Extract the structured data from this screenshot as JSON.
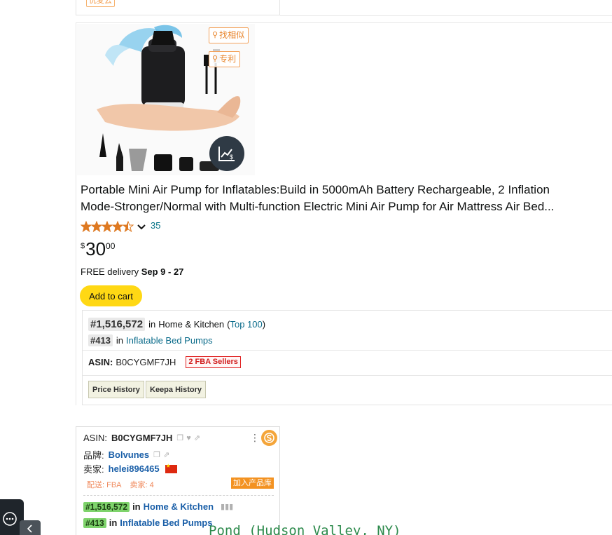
{
  "top_card": {
    "tag": "优麦云"
  },
  "product": {
    "image_tools": {
      "find_similar": "找相似",
      "patent": "专利"
    },
    "title_line1": "Portable Mini Air Pump for Inflatables:Build in 5000mAh Battery Rechargeable, 2 Inflation",
    "title_line2": "Mode-Stronger/Normal with Multi-function Electric Mini Air Pump for Air Mattress Air Bed...",
    "rating": {
      "stars": 4.5,
      "count": "35"
    },
    "price": {
      "symbol": "$",
      "whole": "30",
      "fraction": "00"
    },
    "delivery": {
      "prefix": "FREE delivery",
      "dates": "Sep 9 - 27"
    },
    "add_to_cart": "Add to cart",
    "rank": {
      "main_rank": "#1,516,572",
      "main_in": "in",
      "main_category": "Home & Kitchen",
      "top_link": "Top 100",
      "sub_rank": "#413",
      "sub_in": "in",
      "sub_category": "Inflatable Bed Pumps"
    },
    "asin": {
      "label": "ASIN:",
      "value": "B0CYGMF7JH",
      "fba": "2 FBA Sellers"
    },
    "history": {
      "price_history": "Price History",
      "keepa_history": "Keepa History"
    }
  },
  "extension": {
    "asin_label": "ASIN:",
    "asin_value": "B0CYGMF7JH",
    "brand_label": "品牌:",
    "brand_value": "Bolvunes",
    "seller_label": "卖家:",
    "seller_value": "helei896465",
    "delivery_tag": "配送: FBA",
    "sellers_tag": "卖家: 4",
    "add_library": "加入产品库",
    "rank1_badge": "#1,516,572",
    "rank1_in": "in",
    "rank1_category": "Home & Kitchen",
    "rank2_badge": "#413",
    "rank2_in": "in",
    "rank2_category": "Inflatable Bed Pumps"
  },
  "overlay_text": "Pond (Hudson Valley, NY)",
  "colors": {
    "cart": "#ffd814",
    "link": "#0a6b8a",
    "tag_orange": "#f39221",
    "rank_green": "#7ed36b"
  }
}
